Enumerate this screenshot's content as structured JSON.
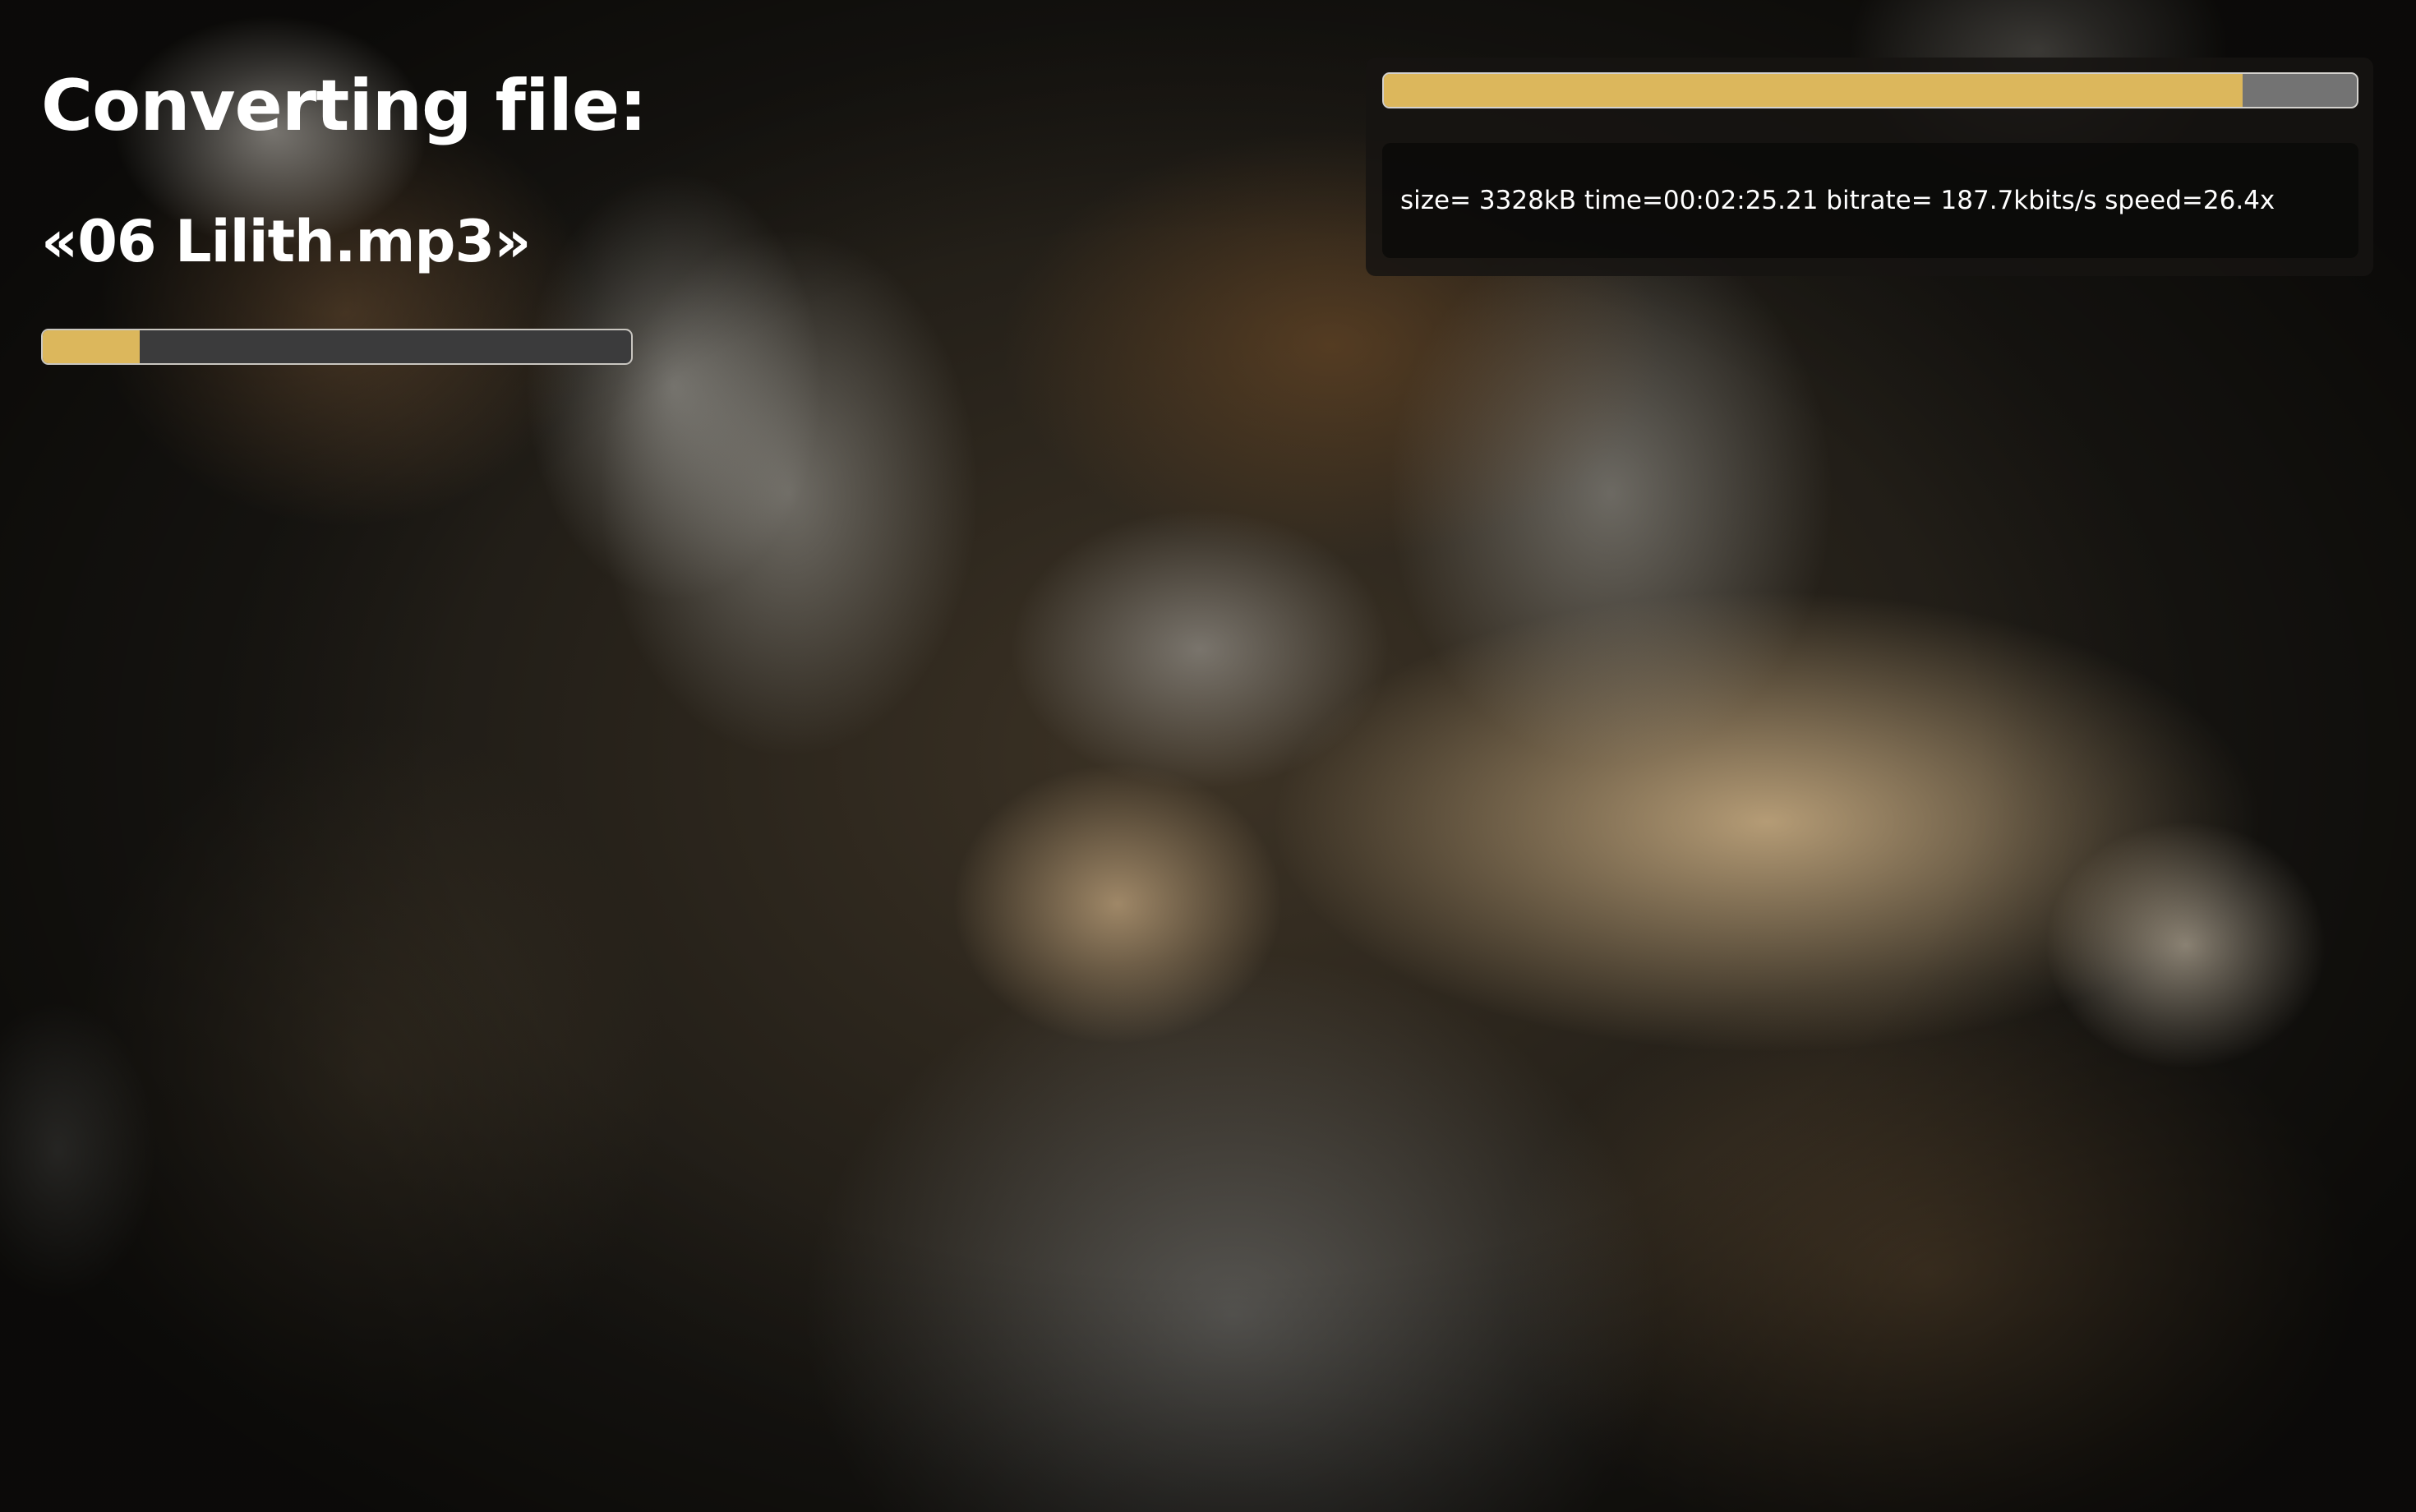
{
  "header": {
    "title": "Converting file:",
    "file_name": "«06 Lilith.mp3»"
  },
  "file_progress": {
    "percent": 16.5
  },
  "log_panel": {
    "total_progress_percent": 88.3,
    "log_text": "size= 3328kB time=00:02:25.21 bitrate= 187.7kbits/s speed=26.4x"
  },
  "colors": {
    "accent": "#dcb75c",
    "track_dark": "#3b3b3c",
    "track_light": "#737373",
    "text": "#ffffff"
  }
}
